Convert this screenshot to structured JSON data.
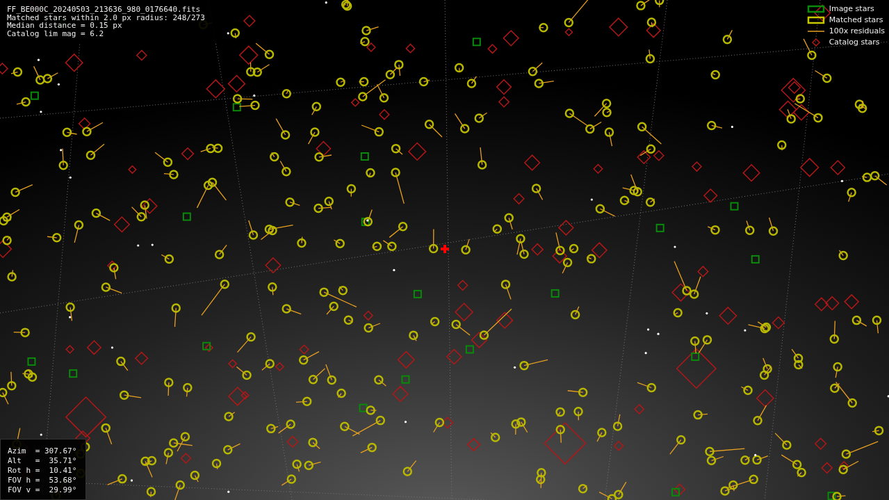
{
  "info": {
    "lines": [
      "FF_BE000C_20240503_213636_980_0176640.fits",
      "Matched stars within 2.0 px radius: 248/273",
      "Median distance = 0.15 px",
      "Catalog lim mag = 6.2"
    ]
  },
  "legend": [
    {
      "label": "Image stars",
      "kind": "image"
    },
    {
      "label": "Matched stars",
      "kind": "matched"
    },
    {
      "label": "100x residuals",
      "kind": "residual"
    },
    {
      "label": "Catalog stars",
      "kind": "catalog"
    }
  ],
  "pointing": {
    "lines": [
      "Azim  = 307.67°",
      "Alt   =  35.71°",
      "Rot h =  10.41°",
      "FOV h =  53.68°",
      "FOV v =  29.99°"
    ]
  }
}
